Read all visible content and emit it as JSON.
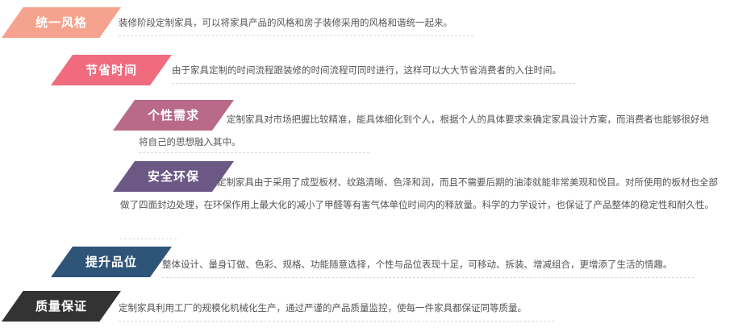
{
  "items": [
    {
      "tag": "统一风格",
      "color": "#f5a38e",
      "desc": "装修阶段定制家具，可以将家具产品的风格和房子装修采用的风格和谐统一起来。"
    },
    {
      "tag": "节省时间",
      "color": "#ef6b7d",
      "desc": "由于家具定制的时间流程跟装修的时间流程可同时进行，这样可以大大节省消费者的入住时间。"
    },
    {
      "tag": "个性需求",
      "color": "#b86a88",
      "desc": "定制家具对市场把握比较精准，能具体细化到个人，根据个人的具体要求来确定家具设计方案，而消费者也能够很好地将自己的思想融入其中。"
    },
    {
      "tag": "安全环保",
      "color": "#6b5884",
      "desc": "定制家具由于采用了成型板材、纹路清晰、色泽和润，而且不需要后期的油漆就能非常美观和悦目。对所使用的板材也全部做了四面封边处理，在环保作用上最大化的减小了甲醛等有害气体单位时间内的释放量。科学的力学设计，也保证了产品整体的稳定性和耐久性。"
    },
    {
      "tag": "提升品位",
      "color": "#2e5478",
      "desc": "整体设计、量身订做、色彩、规格、功能随意选择，个性与品位表现十足，可移动、拆装、增减组合，更增添了生活的情趣。"
    },
    {
      "tag": "质量保证",
      "color": "#333333",
      "desc": "定制家具利用工厂的规模化机械化生产，通过严谨的产品质量监控，使每一件家具都保证同等质量。"
    }
  ]
}
